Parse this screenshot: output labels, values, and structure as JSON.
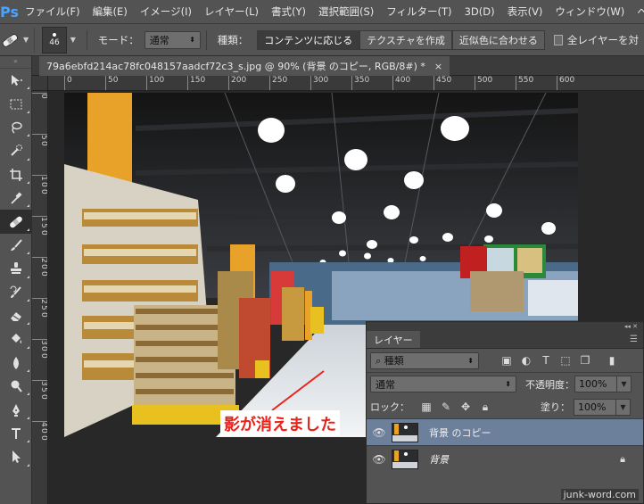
{
  "app": {
    "logo": "Ps"
  },
  "menu": [
    "ファイル(F)",
    "編集(E)",
    "イメージ(I)",
    "レイヤー(L)",
    "書式(Y)",
    "選択範囲(S)",
    "フィルター(T)",
    "3D(D)",
    "表示(V)",
    "ウィンドウ(W)",
    "ヘ"
  ],
  "options": {
    "brush_size": "46",
    "mode_label": "モード：",
    "mode_value": "通常",
    "type_label": "種類：",
    "type_buttons": [
      "コンテンツに応じる",
      "テクスチャを作成",
      "近似色に合わせる"
    ],
    "type_selected": "コンテンツに応じる",
    "all_layers_label": "全レイヤーを対"
  },
  "document": {
    "tab_title": "79a6ebfd214ac78fc048157aadcf72c3_s.jpg @ 90% (背景 のコピー, RGB/8#) *",
    "close_glyph": "×"
  },
  "ruler_top": [
    "0",
    "50",
    "100",
    "150",
    "200",
    "250",
    "300",
    "350",
    "400",
    "450",
    "500",
    "550",
    "600"
  ],
  "ruler_left": [
    "0",
    "5",
    "0",
    "1",
    "0",
    "0",
    "1",
    "5",
    "0",
    "2",
    "0",
    "0",
    "2",
    "5",
    "0",
    "3",
    "0",
    "0",
    "3",
    "5",
    "0",
    "4",
    "0",
    "0"
  ],
  "annotation": {
    "text": "影が消えました",
    "color": "#e8231a"
  },
  "tools": [
    "move-tool-icon",
    "marquee-tool-icon",
    "lasso-tool-icon",
    "quick-select-tool-icon",
    "crop-tool-icon",
    "eyedropper-tool-icon",
    "spot-healing-tool-icon",
    "brush-tool-icon",
    "clone-stamp-tool-icon",
    "history-brush-tool-icon",
    "eraser-tool-icon",
    "paint-bucket-tool-icon",
    "blur-tool-icon",
    "dodge-tool-icon",
    "pen-tool-icon",
    "type-tool-icon",
    "path-select-tool-icon"
  ],
  "layers_panel": {
    "title": "レイヤー",
    "filter_value": "種類",
    "blend_mode": "通常",
    "opacity_label": "不透明度：",
    "opacity_value": "100%",
    "lock_label": "ロック：",
    "fill_label": "塗り：",
    "fill_value": "100%",
    "layers": [
      {
        "name": "背景 のコピー",
        "selected": true,
        "locked": false
      },
      {
        "name": "背景",
        "selected": false,
        "locked": true
      }
    ]
  },
  "watermark": "junk-word.com"
}
